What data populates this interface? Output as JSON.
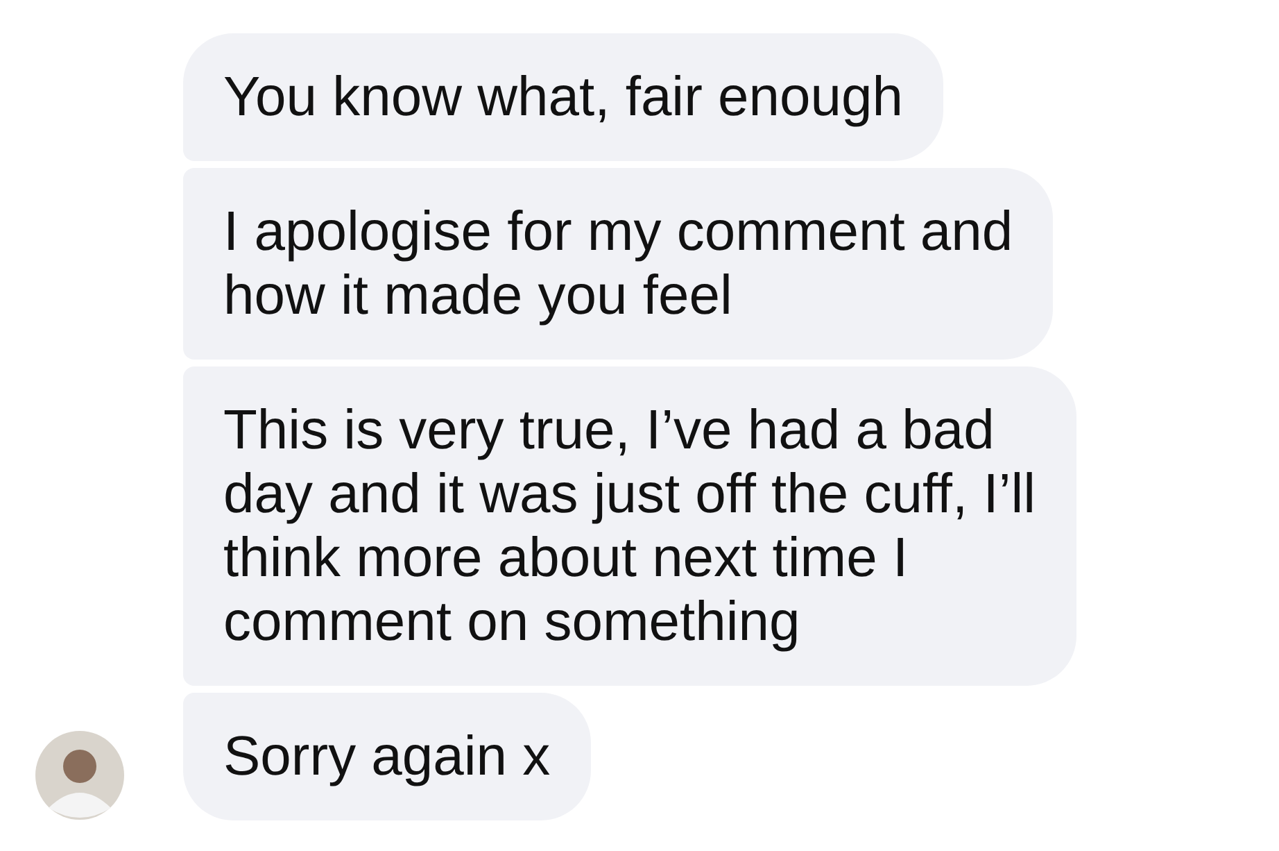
{
  "messages": [
    {
      "lines": [
        "You know what, fair enough"
      ],
      "avatar": false
    },
    {
      "lines": [
        "I apologise for my comment and",
        "how it made you feel"
      ],
      "avatar": false
    },
    {
      "lines": [
        "This is very true, I’ve had a bad",
        "day and it was just off the cuff, I’ll",
        "think more about next time I",
        "comment on something"
      ],
      "avatar": false
    },
    {
      "lines": [
        "Sorry again x"
      ],
      "avatar": true
    }
  ]
}
